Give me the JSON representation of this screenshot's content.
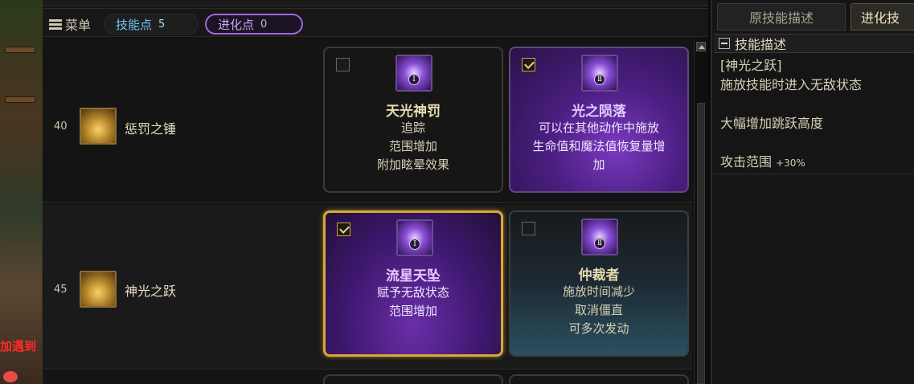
{
  "background": {
    "overlay_text": "加遇到"
  },
  "topbar": {
    "menu_label": "菜单",
    "skill_points_label": "技能点",
    "skill_points_value": "5",
    "evo_points_label": "进化点",
    "evo_points_value": "0"
  },
  "rows": [
    {
      "level": "40",
      "skill_name": "惩罚之锤",
      "options": [
        {
          "title": "天光神罚",
          "roman": "Ⅰ",
          "checked": false,
          "lines": [
            "追踪",
            "范围增加",
            "附加眩晕效果"
          ]
        },
        {
          "title": "光之陨落",
          "roman": "Ⅱ",
          "checked": true,
          "lines": [
            "可以在其他动作中施放",
            "生命值和魔法值恢复量增",
            "加"
          ]
        }
      ]
    },
    {
      "level": "45",
      "skill_name": "神光之跃",
      "options": [
        {
          "title": "流星天坠",
          "roman": "Ⅰ",
          "checked": true,
          "lines": [
            "赋予无敌状态",
            "范围增加"
          ]
        },
        {
          "title": "仲裁者",
          "roman": "Ⅱ",
          "checked": false,
          "lines": [
            "施放时间减少",
            "取消僵直",
            "可多次发动"
          ]
        }
      ]
    }
  ],
  "description": {
    "tab_original": "原技能描述",
    "tab_evolution": "进化技",
    "header": "技能描述",
    "skill_tag": "[神光之跃]",
    "line1": "施放技能时进入无敌状态",
    "line2": "大幅增加跳跃高度",
    "range_label": "攻击范围",
    "range_value": "+30%"
  },
  "colors": {
    "skill_points": "#6ec8f0",
    "evo_points": "#c9a6f2",
    "selected_border": "#d8a838"
  }
}
